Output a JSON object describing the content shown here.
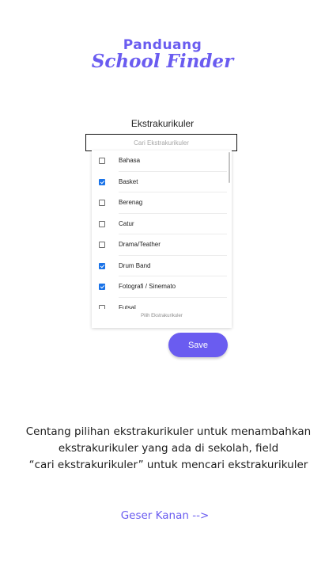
{
  "logo": {
    "line1": "Panduang",
    "line2": "School Finder"
  },
  "colors": {
    "accent": "#6a5cf0",
    "checkbox_checked": "#1a73e8"
  },
  "panel": {
    "title": "Ekstrakurikuler",
    "search_placeholder": "Cari Ekstrakurikuler",
    "items": [
      {
        "label": "Bahasa",
        "checked": false
      },
      {
        "label": "Basket",
        "checked": true
      },
      {
        "label": "Berenag",
        "checked": false
      },
      {
        "label": "Catur",
        "checked": false
      },
      {
        "label": "Drama/Teather",
        "checked": false
      },
      {
        "label": "Drum Band",
        "checked": true
      },
      {
        "label": "Fotografi / Sinemato",
        "checked": true
      },
      {
        "label": "Futsal",
        "checked": false
      }
    ],
    "footer": "Pilih Ekstrakurikuler",
    "save_label": "Save"
  },
  "instruction": {
    "line1": "Centang pilihan ekstrakurikuler untuk menambahkan",
    "line2": "ekstrakurikuler yang ada di sekolah, field",
    "line3": "“cari ekstrakurikuler” untuk mencari ekstrakurikuler"
  },
  "swipe_hint": "Geser Kanan -->"
}
